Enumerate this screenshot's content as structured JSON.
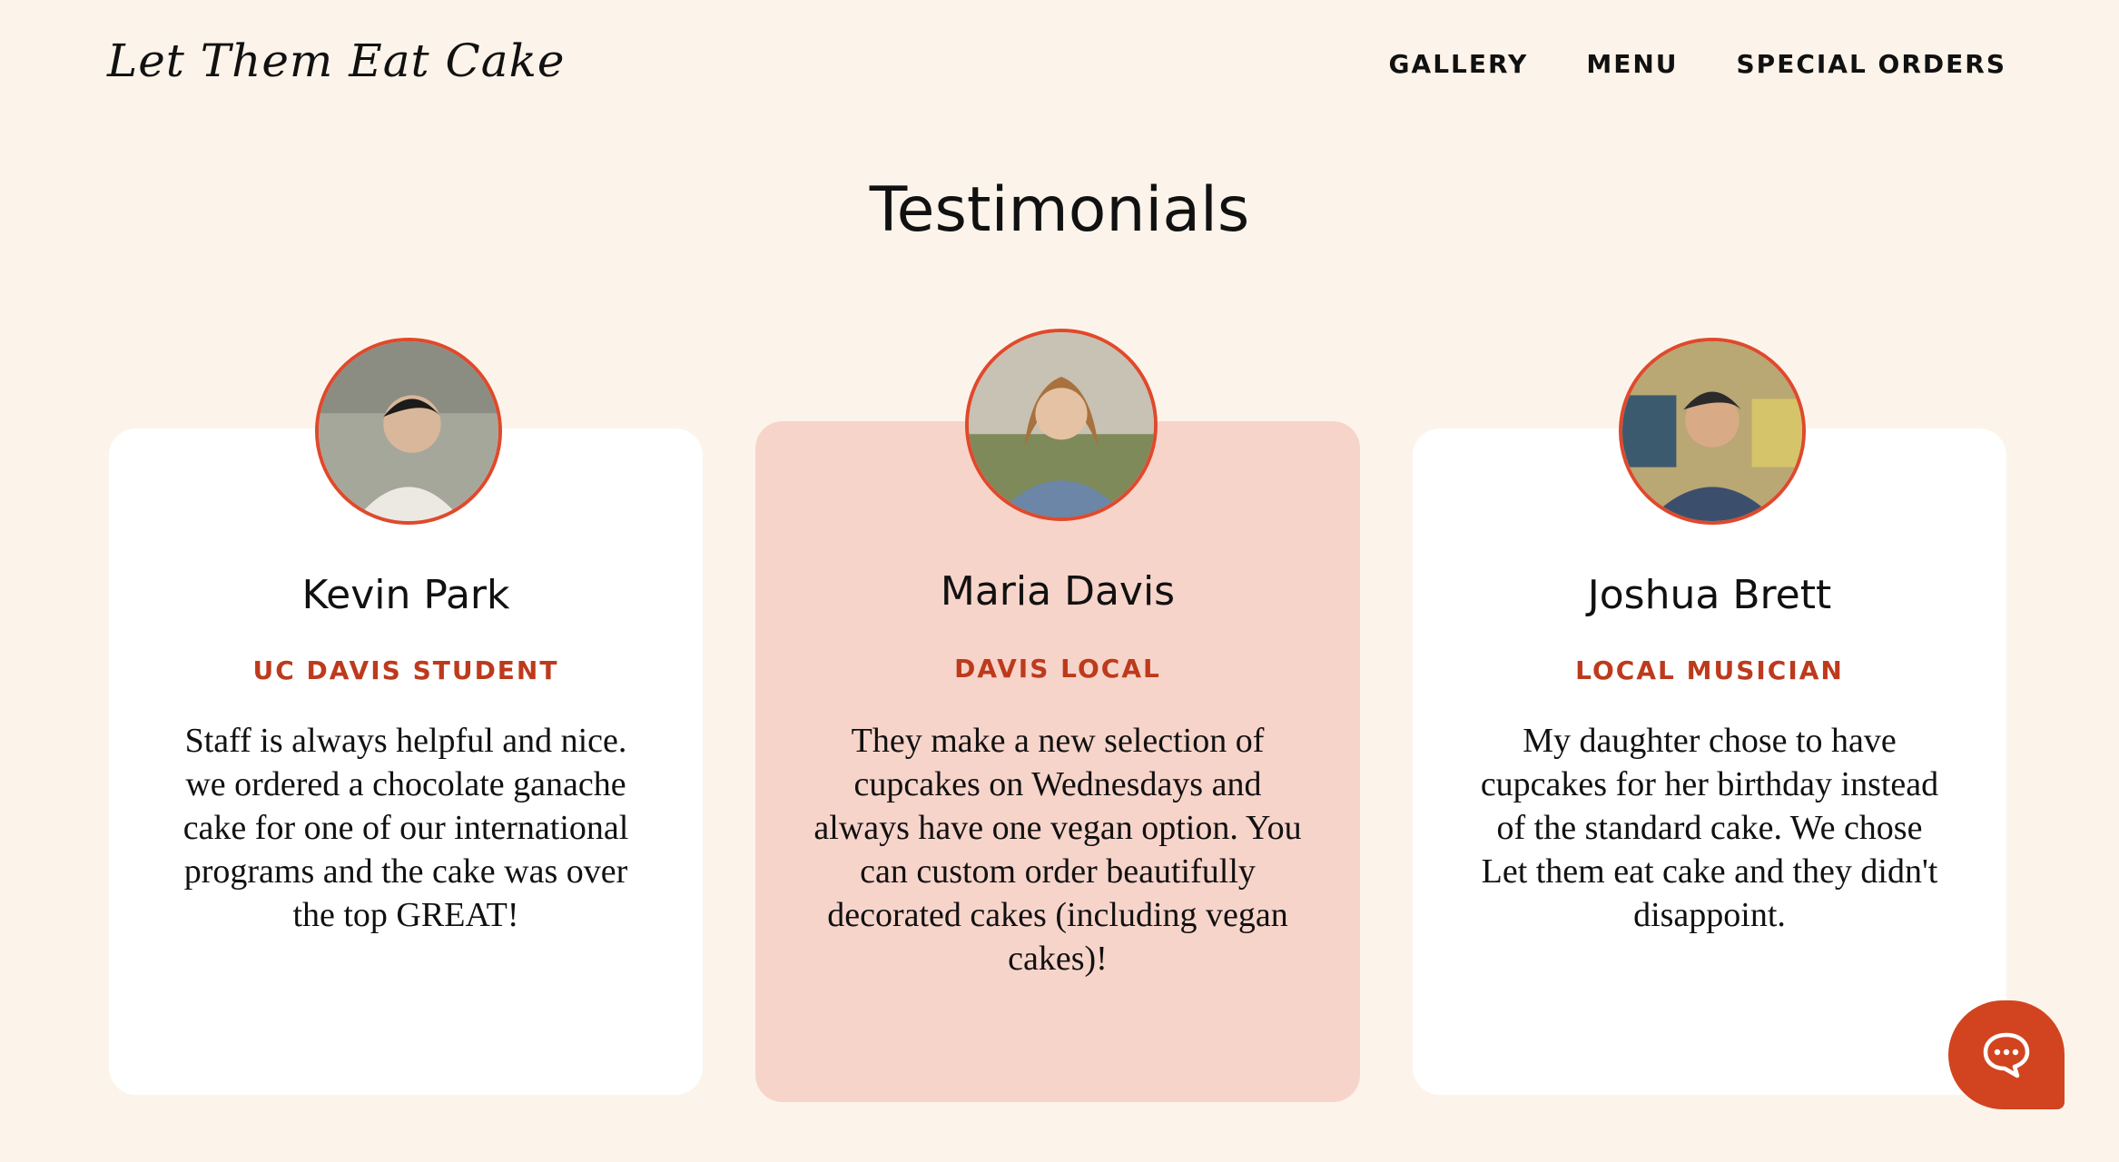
{
  "header": {
    "logo": "Let Them Eat Cake",
    "nav": [
      "GALLERY",
      "MENU",
      "SPECIAL ORDERS"
    ]
  },
  "section": {
    "title": "Testimonials"
  },
  "testimonials": [
    {
      "name": "Kevin Park",
      "role": "UC DAVIS STUDENT",
      "quote": "Staff is always helpful and nice. we ordered a chocolate ganache cake for one of our international programs and the cake was over the top GREAT!"
    },
    {
      "name": "Maria Davis",
      "role": "DAVIS LOCAL",
      "quote": "They make a new selection of cupcakes on Wednesdays and always have one vegan option. You can custom order beautifully decorated cakes (including vegan cakes)!"
    },
    {
      "name": "Joshua Brett",
      "role": "LOCAL MUSICIAN",
      "quote": "My daughter chose to have cupcakes for her birthday instead of the standard cake. We chose Let them eat cake and they didn't disappoint."
    }
  ],
  "icons": {
    "chat": "chat-bubble-icon"
  },
  "colors": {
    "background": "#fcf4ea",
    "accent": "#d2441f",
    "role_text": "#bd3a1c",
    "featured_card": "#f7d4ca"
  }
}
